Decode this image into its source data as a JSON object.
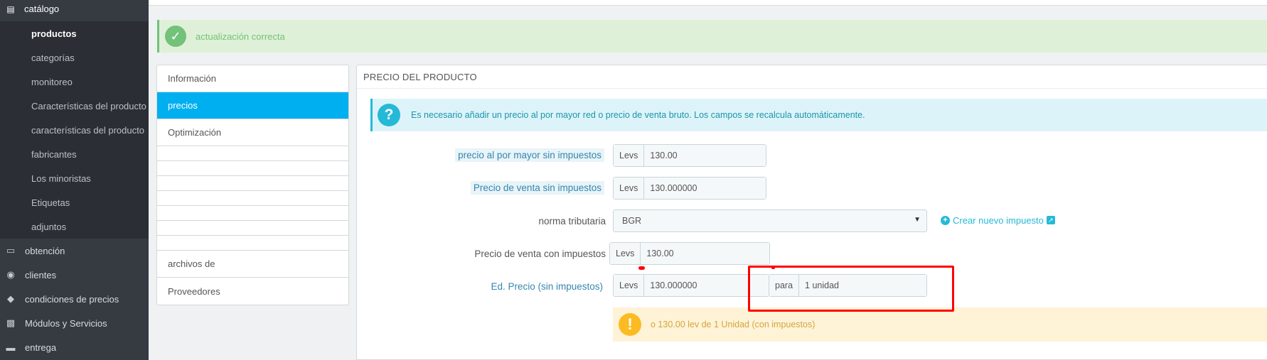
{
  "sidebar": {
    "top_item": {
      "label": "catálogo",
      "icon": "book-icon"
    },
    "sub_items": [
      {
        "label": "productos",
        "active": true
      },
      {
        "label": "categorías",
        "active": false
      },
      {
        "label": "monitoreo",
        "active": false
      },
      {
        "label": "Características del producto",
        "active": false
      },
      {
        "label": "características del producto",
        "active": false
      },
      {
        "label": "fabricantes",
        "active": false
      },
      {
        "label": "Los minoristas",
        "active": false
      },
      {
        "label": "Etiquetas",
        "active": false
      },
      {
        "label": "adjuntos",
        "active": false
      }
    ],
    "main_items": [
      {
        "label": "obtención",
        "icon": "credit-card-icon"
      },
      {
        "label": "clientes",
        "icon": "users-icon"
      },
      {
        "label": "condiciones de precios",
        "icon": "tags-icon"
      },
      {
        "label": "Módulos y Servicios",
        "icon": "puzzle-icon"
      },
      {
        "label": "entrega",
        "icon": "truck-icon"
      }
    ]
  },
  "alert_success": {
    "text": "actualización correcta"
  },
  "tabs": {
    "items": [
      "Información",
      "precios",
      "Optimización",
      "archivos de",
      "Proveedores"
    ],
    "active": "precios"
  },
  "panel": {
    "title": "PRECIO DEL PRODUCTO",
    "info_text": "Es necesario añadir un precio al por mayor red o precio de venta bruto. Los campos se recalcula automáticamente.",
    "fields": {
      "wholesale": {
        "label": "precio al por mayor sin impuestos",
        "currency": "Levs",
        "value": "130.00"
      },
      "retail_excl": {
        "label": "Precio de venta sin impuestos",
        "currency": "Levs",
        "value": "130.000000"
      },
      "tax_rule": {
        "label": "norma tributaria",
        "value": "BGR"
      },
      "retail_incl": {
        "label": "Precio de venta con impuestos",
        "currency": "Levs",
        "value": "130.00"
      },
      "unit_price": {
        "label": "Ed. Precio (sin impuestos)",
        "currency": "Levs",
        "value": "130.000000",
        "per_label": "para",
        "per_value": "1 unidad"
      }
    },
    "new_tax_link": "Crear nuevo impuesto",
    "warning_text": "o 130.00 lev de 1 Unidad (con impuestos)"
  },
  "colors": {
    "sidebar_bg": "#363a41",
    "accent": "#00aff0",
    "success": "#72c279",
    "info": "#25b9d7",
    "warning": "#fbbb22",
    "annotation": "#ff0000"
  }
}
